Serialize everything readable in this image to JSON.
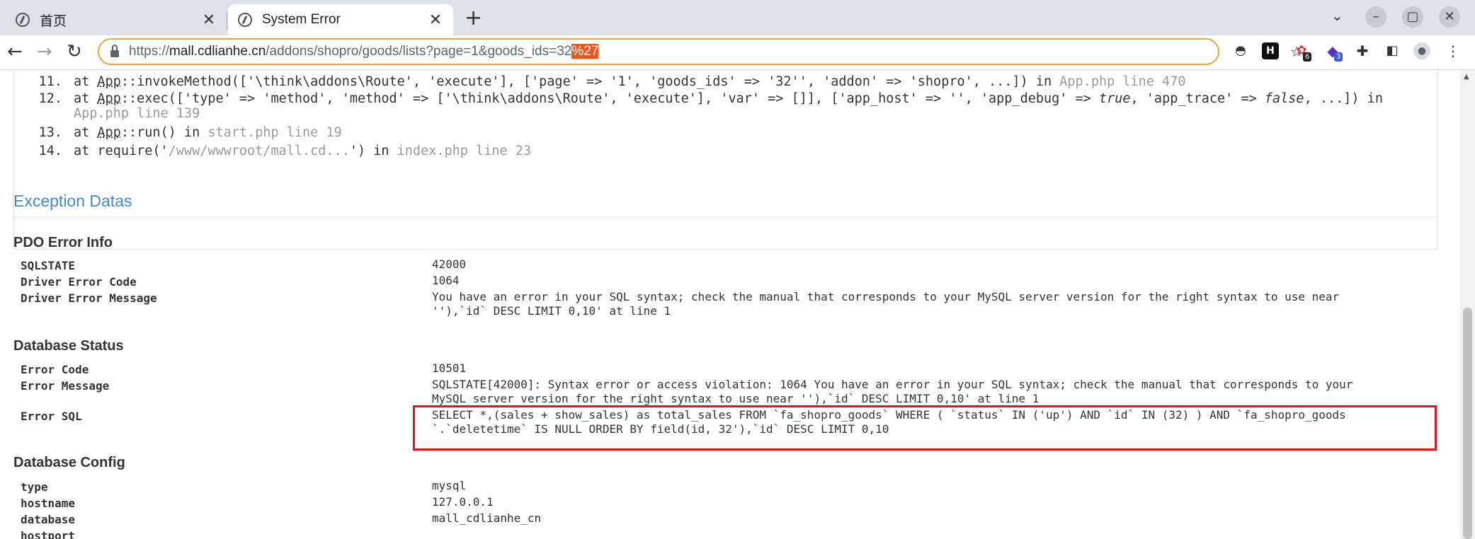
{
  "browser": {
    "tabs": [
      {
        "title": "首页",
        "close": "✕"
      },
      {
        "title": "System Error",
        "close": "✕"
      }
    ],
    "new_tab": "+",
    "url": {
      "scheme": "https://",
      "host": "mall.cdlianhe.cn",
      "path": "/addons/shopro/goods/lists?page=1&goods_ids=32",
      "highlight": "%27"
    },
    "ext_badges": [
      "6",
      "3"
    ]
  },
  "trace": [
    {
      "num": "11.",
      "parts": [
        {
          "t": "at "
        },
        {
          "t": "App",
          "u": true
        },
        {
          "t": "::invokeMethod(['\\think\\addons\\Route', 'execute'], ['page' => '1', 'goods_ids' => '32'', 'addon' => 'shopro', ...]) in "
        },
        {
          "t": "App.php line 470",
          "gray": true
        }
      ]
    },
    {
      "num": "12.",
      "parts": [
        {
          "t": "at "
        },
        {
          "t": "App",
          "u": true
        },
        {
          "t": "::exec(['type' => 'method', 'method' => ['\\think\\addons\\Route', 'execute'], 'var' => []], ['app_host' => '', 'app_debug' => "
        },
        {
          "t": "true",
          "i": true
        },
        {
          "t": ", 'app_trace' => "
        },
        {
          "t": "false",
          "i": true
        },
        {
          "t": ", ...]) in"
        }
      ]
    },
    {
      "num": "",
      "parts": [
        {
          "t": "App.php line 139",
          "gray": true
        }
      ]
    },
    {
      "num": "13.",
      "parts": [
        {
          "t": "at "
        },
        {
          "t": "App",
          "u": true
        },
        {
          "t": "::run() in "
        },
        {
          "t": "start.php line 19",
          "gray": true
        }
      ]
    },
    {
      "num": "14.",
      "parts": [
        {
          "t": "at require('"
        },
        {
          "t": "/www/wwwroot/mall.cd...",
          "gray": true
        },
        {
          "t": "') in "
        },
        {
          "t": "index.php line 23",
          "gray": true
        }
      ]
    }
  ],
  "exception_title": "Exception Datas",
  "pdo": {
    "title": "PDO Error Info",
    "rows": [
      {
        "key": "SQLSTATE",
        "value": "42000"
      },
      {
        "key": "Driver Error Code",
        "value": "1064"
      },
      {
        "key": "Driver Error Message",
        "value": "You have an error in your SQL syntax; check the manual that corresponds to your MySQL server version for the right syntax to use near\n''),`id` DESC LIMIT 0,10' at line 1"
      }
    ]
  },
  "db_status": {
    "title": "Database Status",
    "rows": [
      {
        "key": "Error Code",
        "value": "10501"
      },
      {
        "key": "Error Message",
        "value": "SQLSTATE[42000]: Syntax error or access violation: 1064 You have an error in your SQL syntax; check the manual that corresponds to your\nMySQL server version for the right syntax to use near ''),`id` DESC LIMIT 0,10' at line 1"
      },
      {
        "key": "Error SQL",
        "value": "SELECT *,(sales + show_sales) as total_sales FROM `fa_shopro_goods` WHERE ( `status` IN ('up') AND `id` IN (32) ) AND `fa_shopro_goods\n`.`deletetime` IS NULL ORDER BY field(id, 32'),`id` DESC LIMIT 0,10"
      }
    ]
  },
  "db_config": {
    "title": "Database Config",
    "rows": [
      {
        "key": "type",
        "value": "mysql"
      },
      {
        "key": "hostname",
        "value": "127.0.0.1"
      },
      {
        "key": "database",
        "value": "mall_cdlianhe_cn"
      },
      {
        "key": "hostport",
        "value": ""
      }
    ]
  },
  "colors": {
    "link_blue": "#4288ce",
    "highlight_red": "#e0131f",
    "omnibox_border": "#e8a33d"
  }
}
